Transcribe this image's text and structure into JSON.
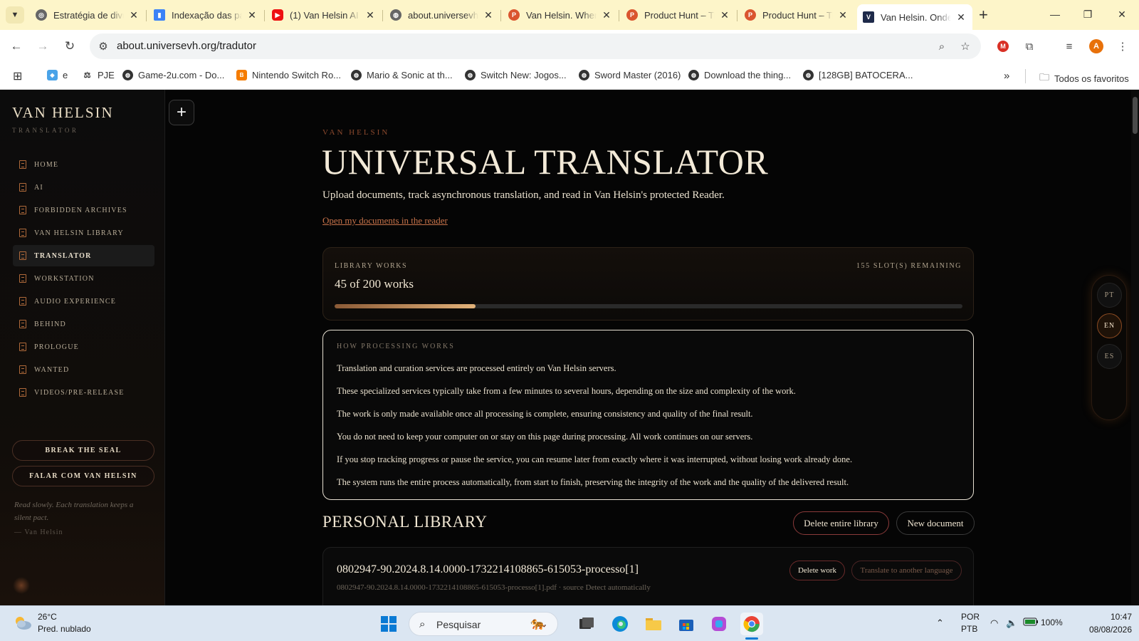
{
  "browser": {
    "tabs": [
      {
        "title": "Estratégia de divulgação",
        "x": 0
      },
      {
        "title": "Indexação das páginas",
        "x": 0
      },
      {
        "title": "(1) Van Helsin AI",
        "x": 0
      },
      {
        "title": "about.universevh.org",
        "x": 0
      },
      {
        "title": "Van Helsin. Where",
        "x": 0
      },
      {
        "title": "Product Hunt – The",
        "x": 0
      },
      {
        "title": "Product Hunt – The",
        "x": 0
      },
      {
        "title": "Van Helsin. Onde",
        "x": 0
      }
    ],
    "url": "about.universevh.org/tradutor",
    "bookmarks": [
      "e",
      "PJE",
      "Game-2u.com - Do...",
      "Nintendo Switch Ro...",
      "Mario & Sonic at th...",
      "Switch New: Jogos...",
      "Sword Master (2016)",
      "Download the thing...",
      "[128GB] BATOCERA..."
    ],
    "all_bookmarks": "Todos os favoritos",
    "profile_initial": "A"
  },
  "sidebar": {
    "logo": "VAN HELSIN",
    "logo_sub": "TRANSLATOR",
    "items": [
      {
        "label": "HOME"
      },
      {
        "label": "AI"
      },
      {
        "label": "FORBIDDEN ARCHIVES"
      },
      {
        "label": "VAN HELSIN LIBRARY"
      },
      {
        "label": "TRANSLATOR"
      },
      {
        "label": "WORKSTATION"
      },
      {
        "label": "AUDIO EXPERIENCE"
      },
      {
        "label": "BEHIND"
      },
      {
        "label": "PROLOGUE"
      },
      {
        "label": "WANTED"
      },
      {
        "label": "VIDEOS/PRE-RELEASE"
      }
    ],
    "break_seal": "BREAK THE SEAL",
    "talk": "FALAR COM VAN HELSIN",
    "quote": "Read slowly. Each translation keeps a silent pact.",
    "quote_by": "— Van Helsin"
  },
  "main": {
    "kicker": "VAN HELSIN",
    "title": "UNIVERSAL TRANSLATOR",
    "lede": "Upload documents, track asynchronous translation, and read in Van Helsin's protected Reader.",
    "open_link": "Open my documents in the reader",
    "library": {
      "label": "LIBRARY WORKS",
      "count": "45 of 200 works",
      "slots": "155 SLOT(S) REMAINING",
      "used": 45,
      "total": 200
    },
    "how": {
      "label": "HOW PROCESSING WORKS",
      "paragraphs": [
        "Translation and curation services are processed entirely on Van Helsin servers.",
        "These specialized services typically take from a few minutes to several hours, depending on the size and complexity of the work.",
        "The work is only made available once all processing is complete, ensuring consistency and quality of the final result.",
        "You do not need to keep your computer on or stay on this page during processing. All work continues on our servers.",
        "If you stop tracking progress or pause the service, you can resume later from exactly where it was interrupted, without losing work already done.",
        "The system runs the entire process automatically, from start to finish, preserving the integrity of the work and the quality of the delivered result."
      ]
    },
    "personal_library": {
      "title": "PERSONAL LIBRARY",
      "delete_all": "Delete entire library",
      "new_doc": "New document",
      "doc": {
        "title": "0802947-90.2024.8.14.0000-1732214108865-615053-processo[1]",
        "meta": "0802947-90.2024.8.14.0000-1732214108865-615053-processo[1].pdf · source Detect automatically",
        "delete": "Delete work",
        "translate": "Translate to another language"
      }
    },
    "languages": [
      "PT",
      "EN",
      "ES"
    ]
  },
  "taskbar": {
    "temp": "26°C",
    "weather": "Pred. nublado",
    "search": "Pesquisar",
    "battery": "100%",
    "lang1": "POR",
    "lang2": "PTB",
    "time": "10:47",
    "date": "08/08/2026"
  },
  "colors": {
    "accent": "#c8734a",
    "progress": "#e2b27a",
    "danger_border": "#8a3a3a"
  }
}
